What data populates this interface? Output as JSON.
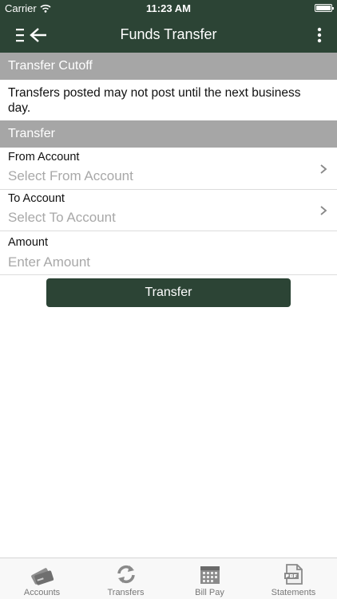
{
  "status_bar": {
    "carrier": "Carrier",
    "time": "11:23 AM"
  },
  "nav": {
    "title": "Funds Transfer",
    "menu_icon": "menu-back-icon",
    "more_icon": "more-vertical-icon"
  },
  "cutoff": {
    "header": "Transfer Cutoff",
    "message": "Transfers posted may not post until the next business day."
  },
  "transfer": {
    "header": "Transfer",
    "from": {
      "label": "From Account",
      "placeholder": "Select From Account"
    },
    "to": {
      "label": "To Account",
      "placeholder": "Select To Account"
    },
    "amount": {
      "label": "Amount",
      "placeholder": "Enter Amount"
    },
    "button": "Transfer"
  },
  "tabs": [
    {
      "label": "Accounts",
      "icon": "cards-icon"
    },
    {
      "label": "Transfers",
      "icon": "refresh-icon"
    },
    {
      "label": "Bill Pay",
      "icon": "calendar-icon"
    },
    {
      "label": "Statements",
      "icon": "pdf-icon"
    }
  ],
  "colors": {
    "brand": "#2c4435",
    "section_header": "#a6a6a6",
    "placeholder": "#a8a8a8"
  }
}
